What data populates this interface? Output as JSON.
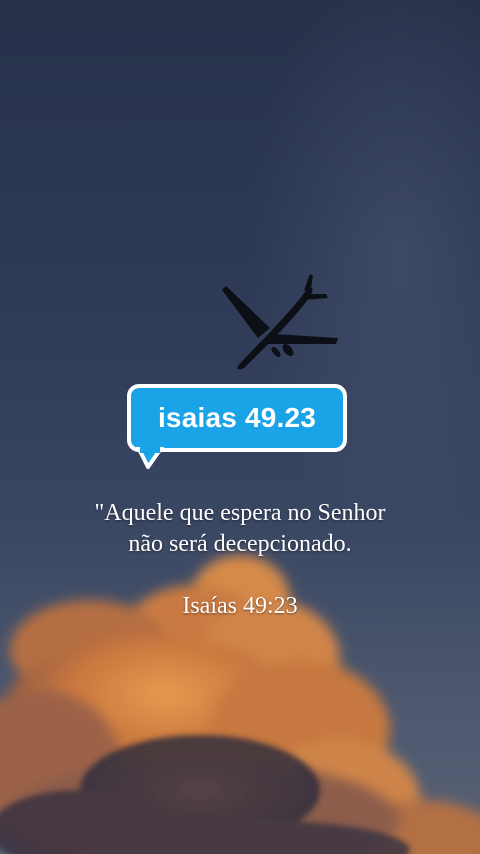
{
  "badge": {
    "label": "isaias 49.23",
    "color": "#1aa3e6"
  },
  "verse": {
    "line1": "\"Aquele que espera no Senhor",
    "line2": "não será decepcionado.",
    "reference": "Isaías 49:23"
  },
  "image": {
    "subject": "airplane silhouette against dusk sky with orange clouds",
    "icon": "airplane-icon"
  }
}
